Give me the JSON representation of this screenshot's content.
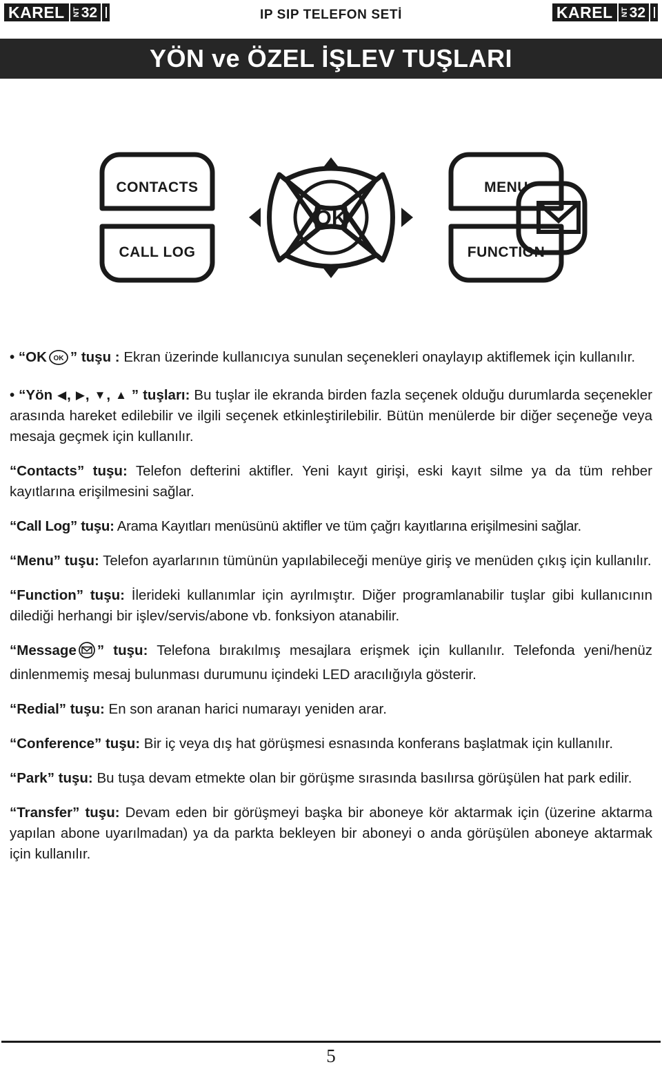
{
  "header": {
    "title": "IP SIP TELEFON SETİ",
    "logo": {
      "word": "KAREL",
      "vertical": "NT",
      "number": "32"
    }
  },
  "banner": {
    "title": "YÖN ve ÖZEL İŞLEV TUŞLARI"
  },
  "diagram": {
    "contacts_label": "CONTACTS",
    "call_log_label": "CALL LOG",
    "menu_label": "MENU",
    "function_label": "FUNCTION",
    "ok_label": "OK",
    "message_icon": "envelope-icon",
    "up_icon": "arrow-up-icon",
    "down_icon": "arrow-down-icon",
    "left_icon": "arrow-left-icon",
    "right_icon": "arrow-right-icon"
  },
  "content": {
    "ok": {
      "bullet": "•",
      "quote_open": "“",
      "key": "OK",
      "icon_label": "OK",
      "quote_close": "”",
      "key_word": " tuşu : ",
      "text": "Ekran üzerinde kullanıcıya sunulan seçenekleri onaylayıp aktiflemek için kullanılır."
    },
    "yon": {
      "bullet": "•",
      "quote_open": "“",
      "key": "Yön ",
      "arrows": [
        "◀",
        "▶",
        "▼",
        "▲"
      ],
      "quote_close": "”",
      "key_word": " tuşları: ",
      "text": "Bu tuşlar ile ekranda birden fazla seçenek olduğu durumlarda seçenekler arasında hareket edilebilir ve ilgili seçenek etkinleştirilebilir. Bütün menülerde bir diğer seçeneğe veya mesaja geçmek için kullanılır."
    },
    "contacts": {
      "key": "“Contacts” tuşu:",
      "text": " Telefon defterini aktifler. Yeni kayıt girişi, eski kayıt silme ya da tüm rehber kayıtlarına erişilmesini sağlar."
    },
    "calllog": {
      "key": "“Call Log” tuşu:",
      "text": " Arama Kayıtları menüsünü aktifler ve tüm çağrı kayıtlarına erişilmesini sağlar."
    },
    "menu": {
      "key": "“Menu” tuşu:",
      "text": " Telefon ayarlarının tümünün yapılabileceği menüye giriş ve menüden çıkış için kullanılır."
    },
    "function": {
      "key": "“Function” tuşu:",
      "text": " İlerideki kullanımlar için ayrılmıştır. Diğer programlanabilir tuşlar gibi kullanıcının dilediği herhangi bir işlev/servis/abone vb. fonksiyon atanabilir."
    },
    "message": {
      "key_pre": "“Message",
      "icon": "envelope-icon",
      "key_post": "” tuşu:",
      "text": " Telefona bırakılmış mesajlara erişmek için kullanılır. Telefonda yeni/henüz dinlenmemiş mesaj bulunması durumunu içindeki LED aracılığıyla gösterir."
    },
    "redial": {
      "key": "“Redial” tuşu:",
      "text": " En son aranan harici numarayı yeniden arar."
    },
    "conference": {
      "key": "“Conference” tuşu:",
      "text": " Bir iç veya dış hat görüşmesi esnasında konferans başlatmak için kullanılır."
    },
    "park": {
      "key": "“Park” tuşu:",
      "text": " Bu tuşa devam etmekte olan bir görüşme sırasında basılırsa görüşülen hat park edilir."
    },
    "transfer": {
      "key": "“Transfer” tuşu:",
      "text": " Devam eden bir görüşmeyi başka bir aboneye kör aktarmak için (üzerine aktarma yapılan abone uyarılmadan) ya da parkta bekleyen bir aboneyi o anda görüşülen aboneye aktarmak için kullanılır."
    }
  },
  "footer": {
    "page_number": "5"
  }
}
